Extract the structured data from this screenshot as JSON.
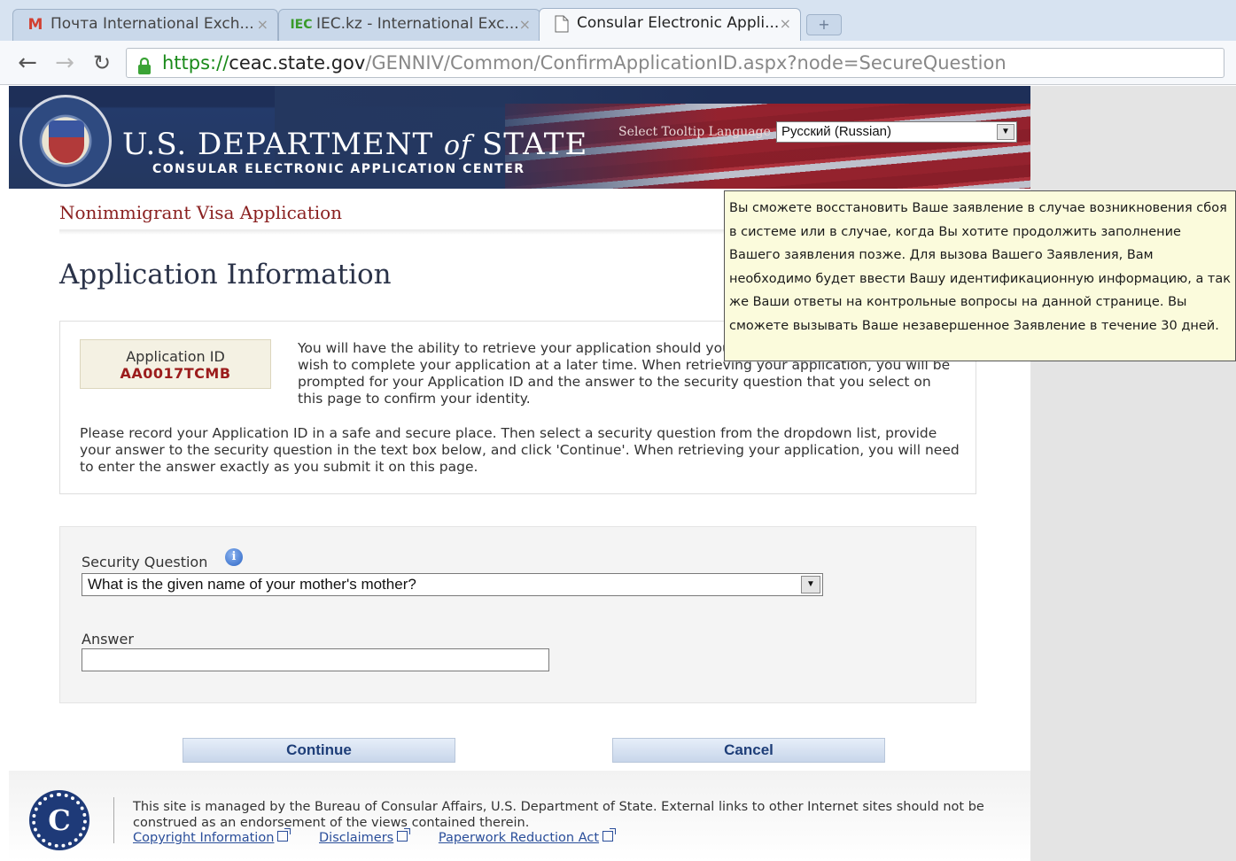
{
  "browser": {
    "tabs": [
      {
        "label": "Почта International Exch...",
        "favicon": "M"
      },
      {
        "label": "IEC.kz - International Exc...",
        "favicon": "IEC"
      },
      {
        "label": "Consular Electronic Appli...",
        "favicon": "page"
      }
    ],
    "url_scheme": "https://",
    "url_host": "ceac.state.gov",
    "url_path": "/GENNIV/Common/ConfirmApplicationID.aspx?node=SecureQuestion"
  },
  "header": {
    "dept_us": "U.S.",
    "dept_department": "DEPARTMENT",
    "dept_of": "of",
    "dept_state": "STATE",
    "subtitle": "CONSULAR ELECTRONIC APPLICATION CENTER",
    "tooltip_language_label": "Select Tooltip Language",
    "tooltip_language_value": "Русский (Russian)"
  },
  "page": {
    "breadcrumb": "Nonimmigrant Visa Application",
    "title": "Application Information",
    "app_id_label": "Application ID",
    "app_id_value": "AA0017TCMB",
    "intro_text": "You will have the ability to retrieve your application should you encounter a system error or wish to complete your application at a later time. When retrieving your application, you will be prompted for your Application ID and the answer to the security question that you select on this page to confirm your identity.",
    "instructions": "Please record your Application ID in a safe and secure place. Then select a security question from the dropdown list, provide your answer to the security question in the text box below, and click 'Continue'. When retrieving your application, you will need to enter the answer exactly as you submit it on this page."
  },
  "form": {
    "security_question_label": "Security Question",
    "security_question_value": "What is the given name of your mother's mother?",
    "answer_label": "Answer",
    "answer_value": ""
  },
  "buttons": {
    "continue": "Continue",
    "cancel": "Cancel"
  },
  "tooltip": {
    "text": "Вы сможете восстановить Ваше заявление в случае возникновения сбоя в системе или в случае, когда Вы хотите продолжить заполнение Вашего заявления позже. Для вызова Вашего Заявления, Вам необходимо будет ввести Вашу идентификационную информацию, а так же Ваши ответы на контрольные вопросы на данной странице. Вы сможете вызывать Ваше незавершенное Заявление в течение 30 дней."
  },
  "footer": {
    "text": "This site is managed by the Bureau of Consular Affairs, U.S. Department of State. External links to other Internet sites should not be construed as an endorsement of the views contained therein.",
    "links": [
      "Copyright Information",
      "Disclaimers",
      "Paperwork Reduction Act"
    ]
  }
}
